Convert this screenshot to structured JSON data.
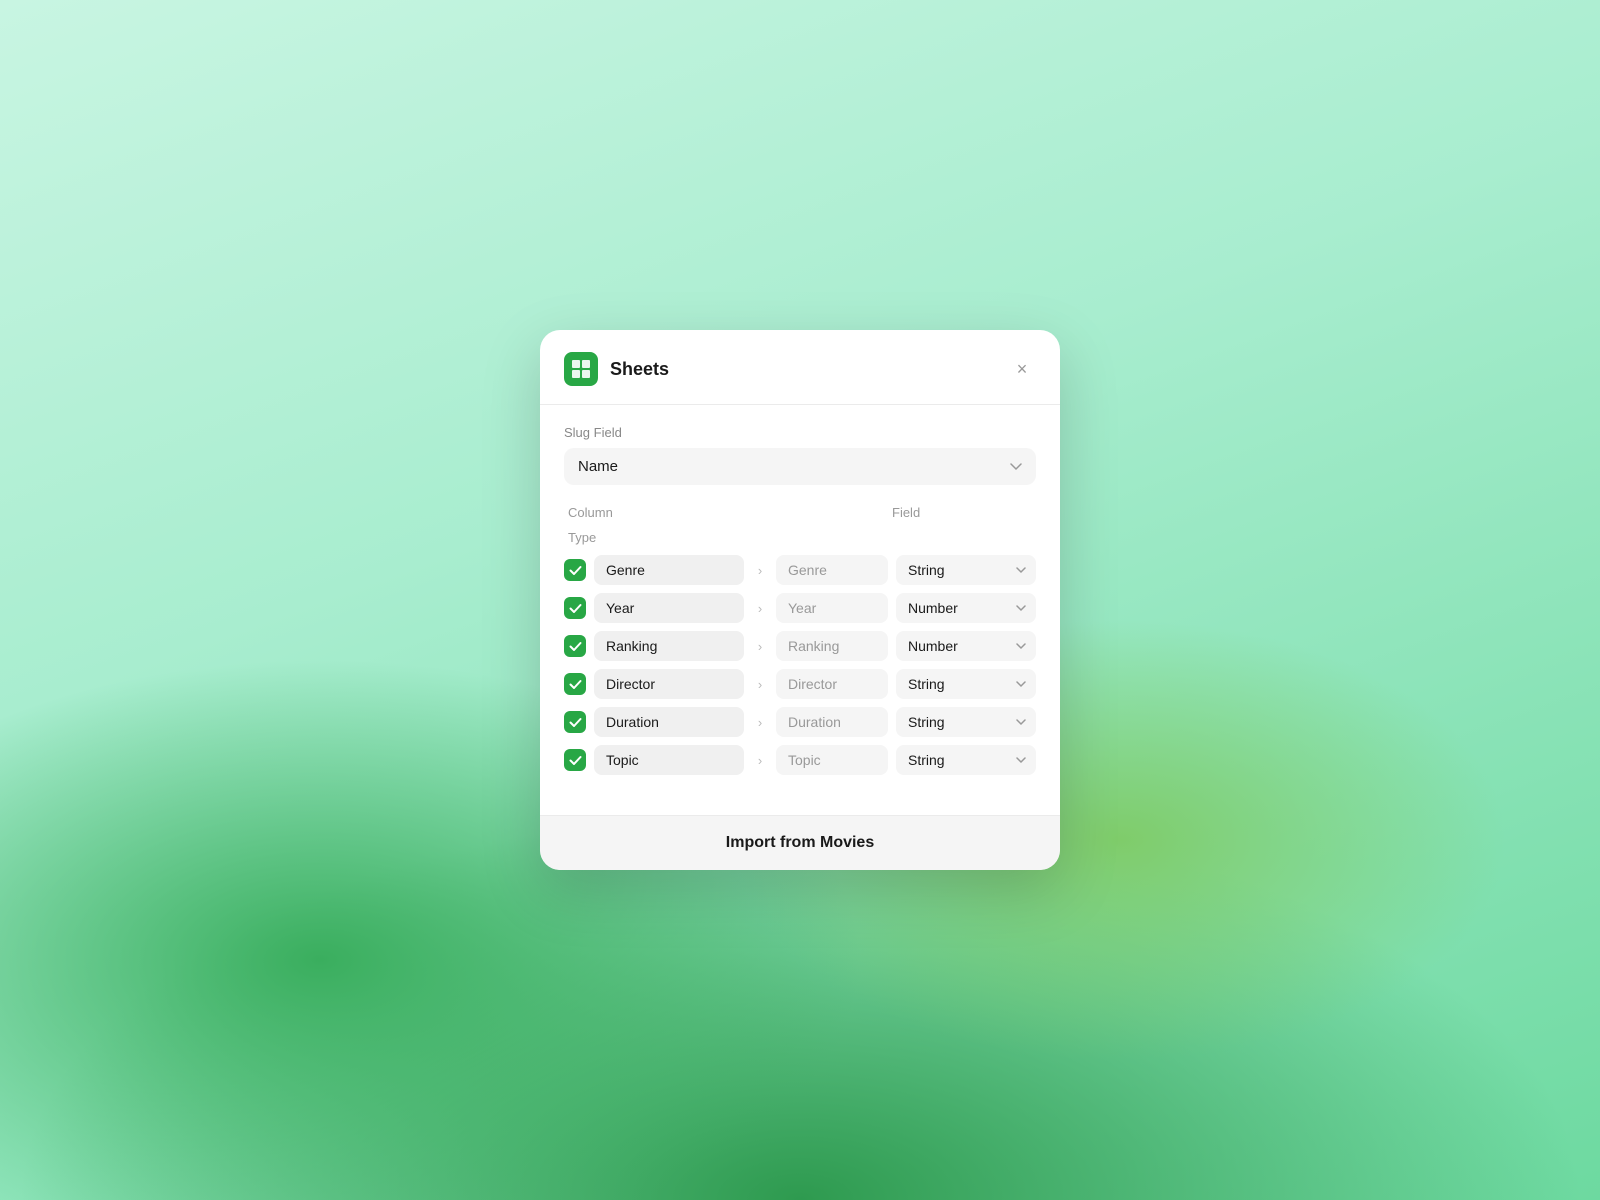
{
  "background": "#b2f0d8",
  "modal": {
    "title": "Sheets",
    "close_label": "×",
    "slug_field_label": "Slug Field",
    "slug_field_value": "Name",
    "columns_header": "Column",
    "field_header": "Field",
    "type_header": "Type",
    "rows": [
      {
        "id": "genre",
        "column": "Genre",
        "field": "Genre",
        "type": "String",
        "checked": true
      },
      {
        "id": "year",
        "column": "Year",
        "field": "Year",
        "type": "Number",
        "checked": true
      },
      {
        "id": "ranking",
        "column": "Ranking",
        "field": "Ranking",
        "type": "Number",
        "checked": true
      },
      {
        "id": "director",
        "column": "Director",
        "field": "Director",
        "type": "String",
        "checked": true
      },
      {
        "id": "duration",
        "column": "Duration",
        "field": "Duration",
        "type": "String",
        "checked": true
      },
      {
        "id": "topic",
        "column": "Topic",
        "field": "Topic",
        "type": "String",
        "checked": true
      }
    ],
    "import_button_label": "Import from Movies"
  }
}
